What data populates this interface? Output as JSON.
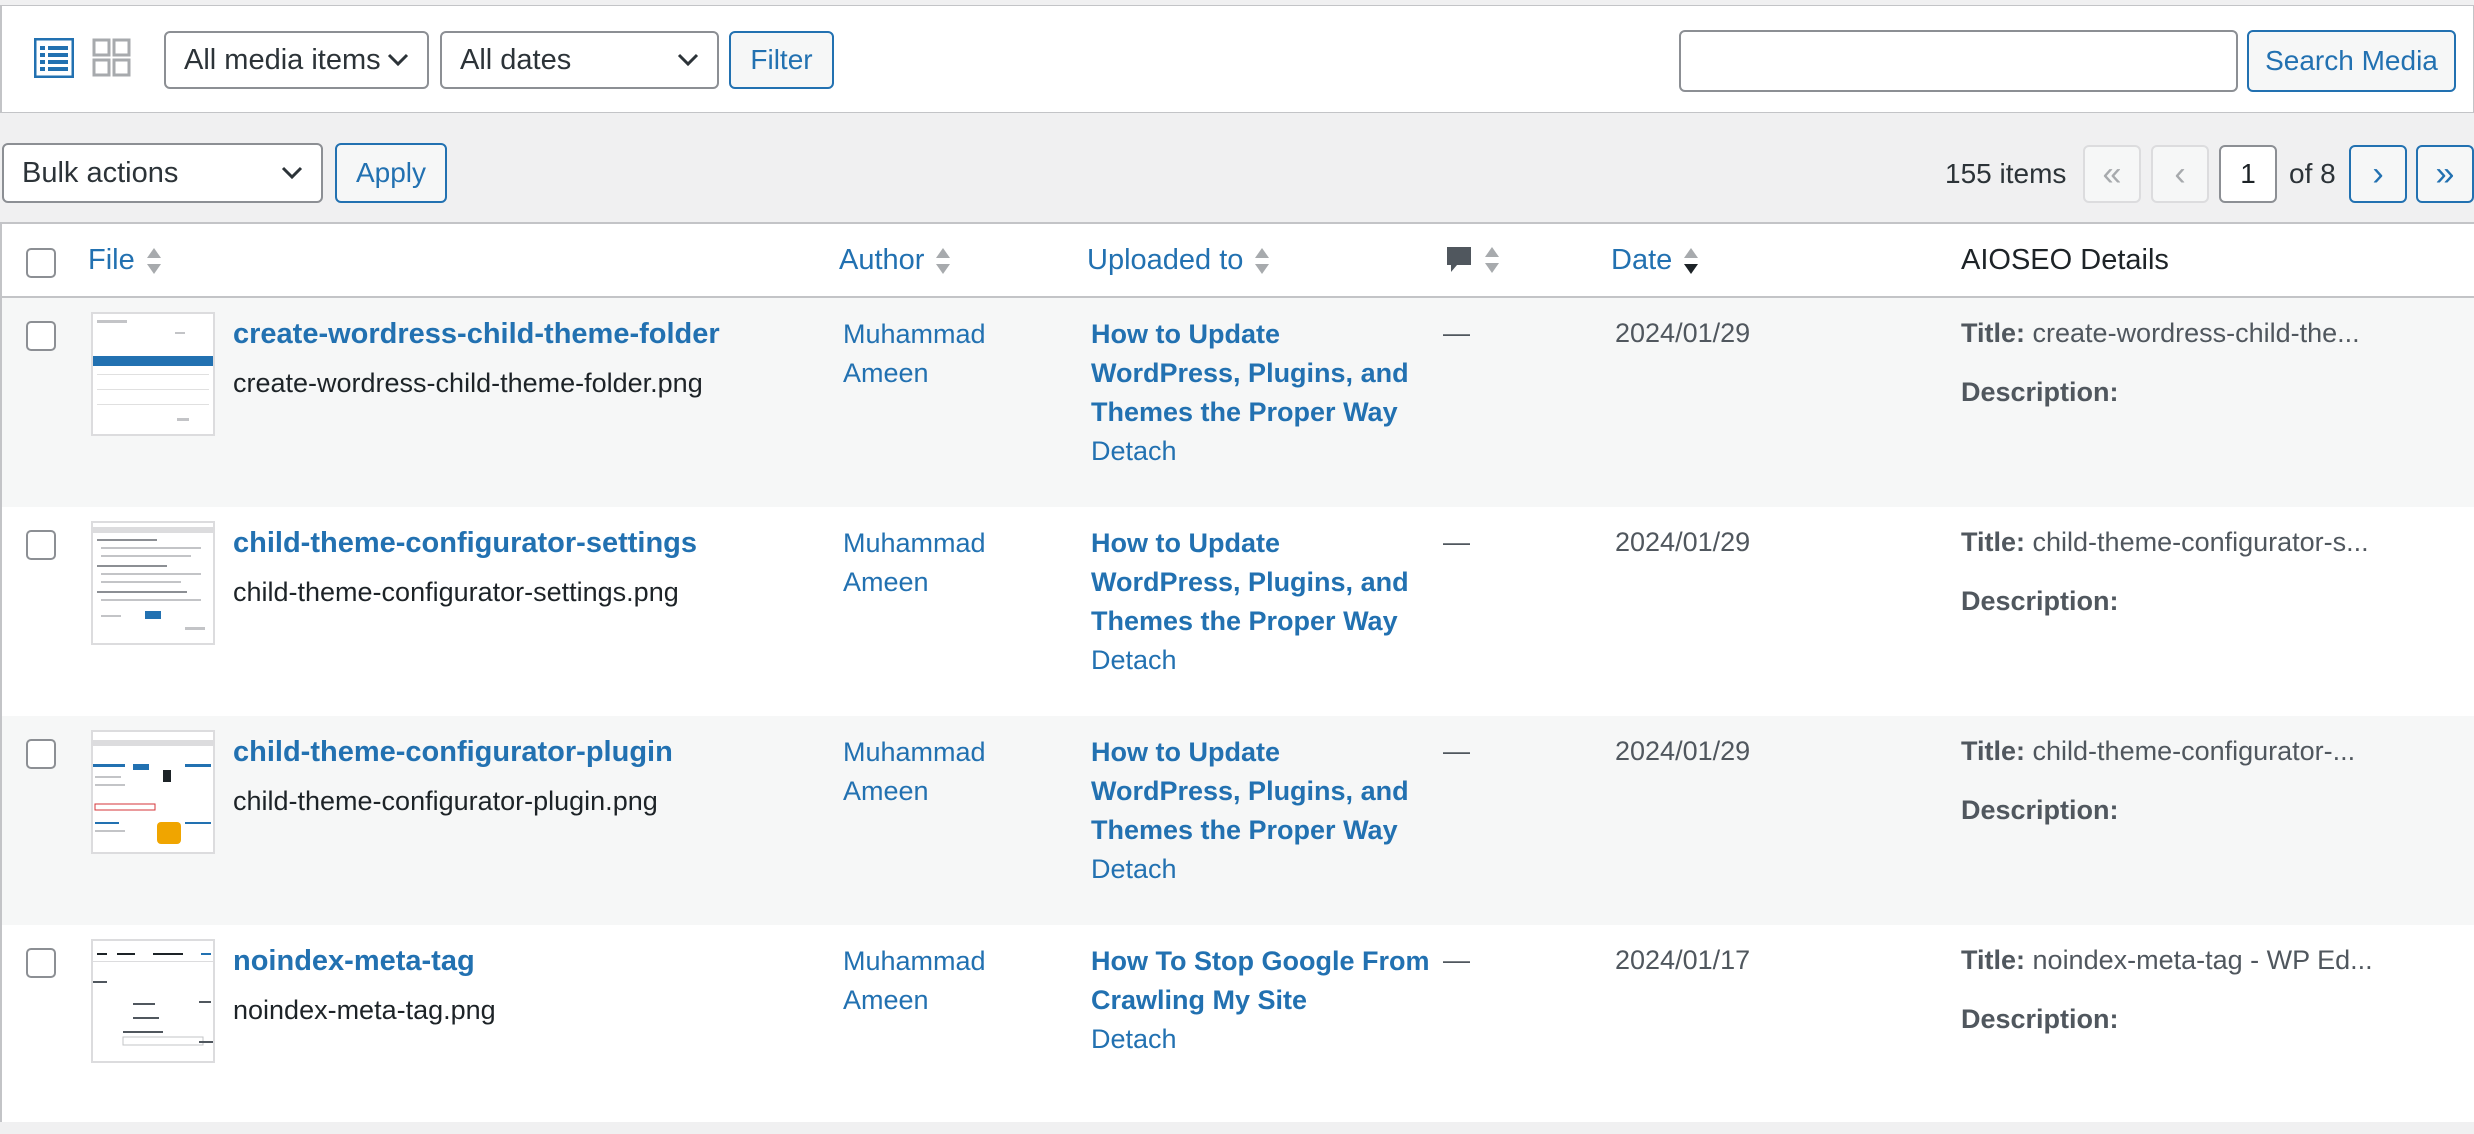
{
  "toolbar": {
    "media_type_select": "All media items",
    "date_select": "All dates",
    "filter_label": "Filter",
    "search_value": "",
    "search_button_label": "Search Media"
  },
  "bulk": {
    "select": "Bulk actions",
    "apply_label": "Apply"
  },
  "pagination": {
    "items_count": "155 items",
    "first": "«",
    "prev": "‹",
    "current_page": "1",
    "of_label": "of 8",
    "next": "›",
    "last": "»"
  },
  "columns": {
    "file": "File",
    "author": "Author",
    "uploaded_to": "Uploaded to",
    "comments_icon": "comment-bubble-icon",
    "date": "Date",
    "aioseo": "AIOSEO Details"
  },
  "labels": {
    "title": "Title:",
    "description": "Description:",
    "detach": "Detach"
  },
  "rows": [
    {
      "title": "create-wordress-child-theme-folder",
      "filename": "create-wordress-child-theme-folder.png",
      "author_first": "Muhammad",
      "author_last": "Ameen",
      "uploaded_to": "How to Update WordPress, Plugins, and Themes the Proper Way",
      "comments": "—",
      "date": "2024/01/29",
      "seo_title": "create-wordress-child-the..."
    },
    {
      "title": "child-theme-configurator-settings",
      "filename": "child-theme-configurator-settings.png",
      "author_first": "Muhammad",
      "author_last": "Ameen",
      "uploaded_to": "How to Update WordPress, Plugins, and Themes the Proper Way",
      "comments": "—",
      "date": "2024/01/29",
      "seo_title": "child-theme-configurator-s..."
    },
    {
      "title": "child-theme-configurator-plugin",
      "filename": "child-theme-configurator-plugin.png",
      "author_first": "Muhammad",
      "author_last": "Ameen",
      "uploaded_to": "How to Update WordPress, Plugins, and Themes the Proper Way",
      "comments": "—",
      "date": "2024/01/29",
      "seo_title": "child-theme-configurator-..."
    },
    {
      "title": "noindex-meta-tag",
      "filename": "noindex-meta-tag.png",
      "author_first": "Muhammad",
      "author_last": "Ameen",
      "uploaded_to": "How To Stop Google From Crawling My Site",
      "comments": "—",
      "date": "2024/01/17",
      "seo_title": "noindex-meta-tag - WP Ed..."
    }
  ],
  "colors": {
    "accent": "#2271b1",
    "page_bg": "#f0f0f1",
    "alt_row": "#f6f7f7",
    "border": "#c3c4c7"
  }
}
